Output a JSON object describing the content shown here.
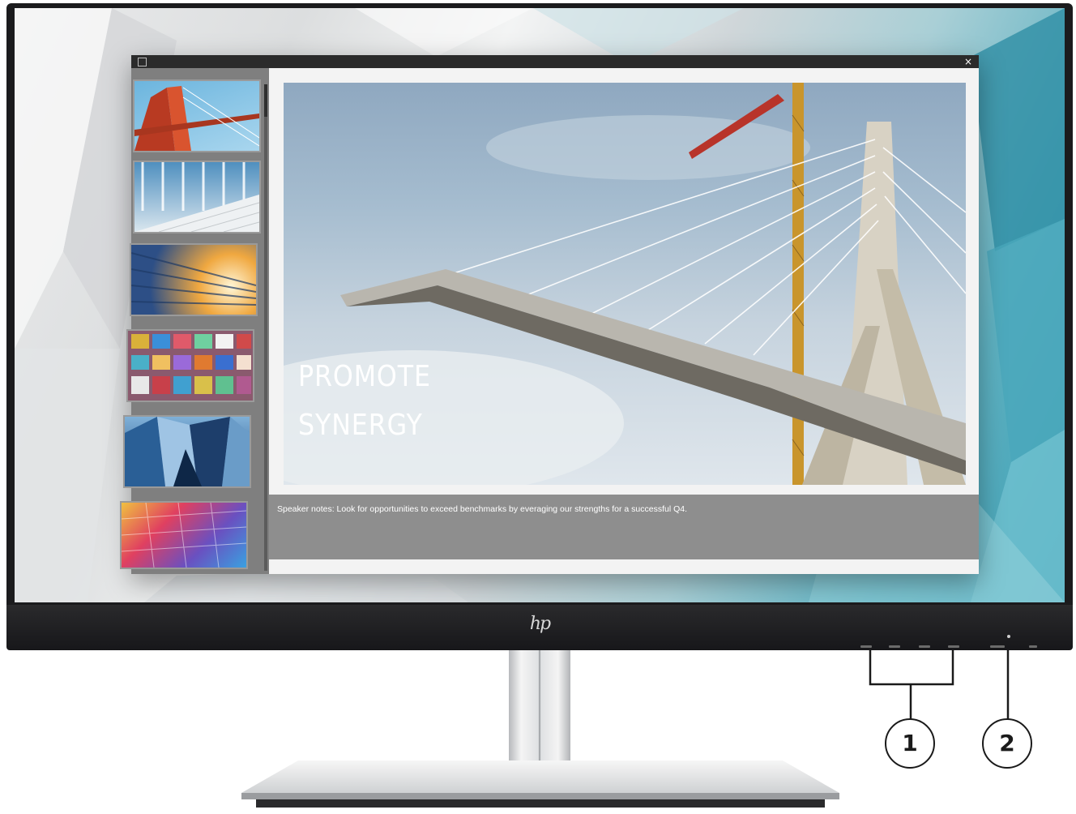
{
  "monitor": {
    "brand_logo": "hp",
    "callouts": [
      "1",
      "2"
    ],
    "osd_button_count": 4,
    "colors": {
      "bezel": "#1b1b1d",
      "accent": "#3c9fb4"
    }
  },
  "app": {
    "title_icon": "window-icon",
    "close_label": "×",
    "thumbnails": [
      {
        "name": "thumb-red-bridge"
      },
      {
        "name": "thumb-glass-stairs"
      },
      {
        "name": "thumb-sunburst-facade"
      },
      {
        "name": "thumb-colorful-windows"
      },
      {
        "name": "thumb-blue-towers"
      },
      {
        "name": "thumb-rainbow-building"
      }
    ],
    "slide": {
      "title_line1": "PROMOTE",
      "title_line2": "SYNERGY"
    },
    "notes": "Speaker notes: Look for opportunities to exceed benchmarks by everaging our strengths for a successful Q4."
  }
}
